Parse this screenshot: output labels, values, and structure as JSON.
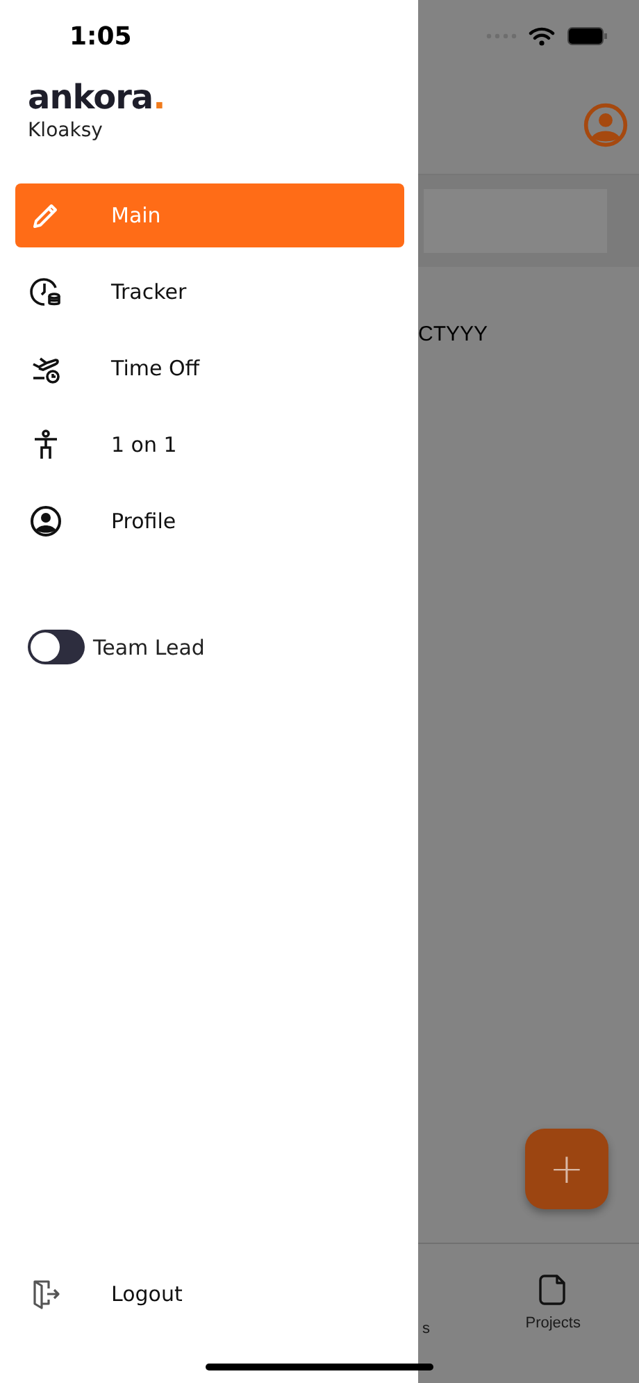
{
  "status_bar": {
    "time": "1:05"
  },
  "drawer": {
    "logo": "ankora",
    "logo_dot": ".",
    "company": "Kloaksy",
    "menu": [
      {
        "kind": "pencil",
        "label": "Main",
        "selected": true
      },
      {
        "kind": "clock",
        "label": "Tracker",
        "selected": false
      },
      {
        "kind": "plane",
        "label": "Time Off",
        "selected": false
      },
      {
        "kind": "person",
        "label": "1 on 1",
        "selected": false
      },
      {
        "kind": "profile",
        "label": "Profile",
        "selected": false
      }
    ],
    "toggle": {
      "label": "Team Lead",
      "on": false
    },
    "logout": {
      "label": "Logout"
    }
  },
  "background": {
    "content_text": "CTYYY",
    "fab": "+",
    "tabs": [
      {
        "label": "s"
      },
      {
        "label": "Projects"
      }
    ]
  }
}
